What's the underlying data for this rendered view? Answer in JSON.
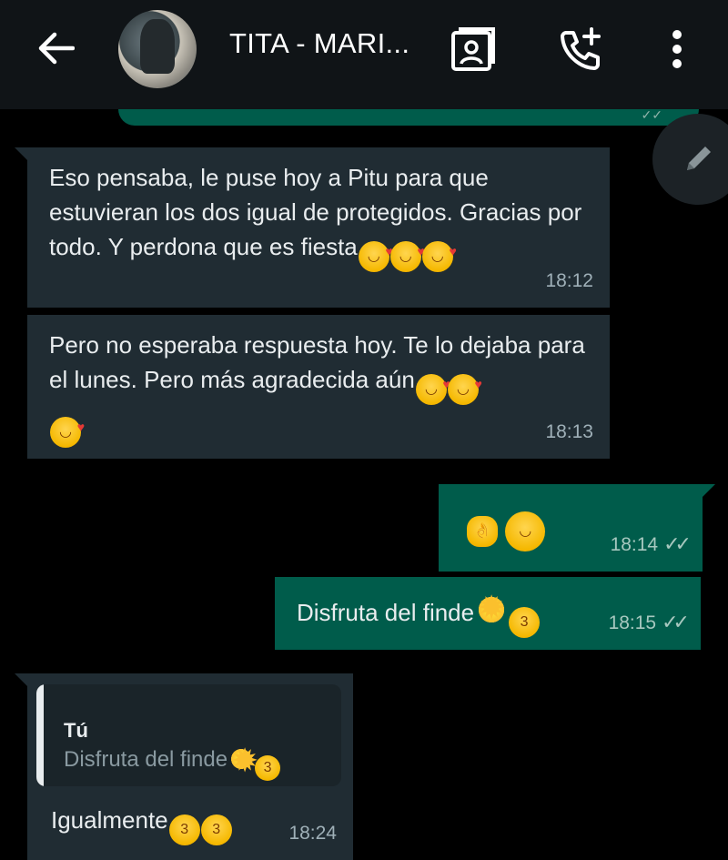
{
  "header": {
    "back_icon": "arrow-left-icon",
    "contact_name": "TITA - MARI...",
    "contact_card_icon": "contact-card-icon",
    "add_call_icon": "call-add-icon",
    "menu_icon": "more-vertical-icon"
  },
  "fab": {
    "icon": "pencil-icon"
  },
  "messages": [
    {
      "direction": "in",
      "text": "Eso pensaba, le puse hoy a Pitu para que estuvieran los dos igual de protegidos. Gracias por todo. Y perdona que es fiesta",
      "emojis": [
        "smiling-face-with-hearts",
        "smiling-face-with-hearts",
        "smiling-face-with-hearts"
      ],
      "time": "18:12"
    },
    {
      "direction": "in",
      "text": "Pero no esperaba respuesta hoy. Te lo dejaba para el lunes. Pero más agradecida aún",
      "emojis": [
        "smiling-face-with-hearts",
        "smiling-face-with-hearts",
        "smiling-face-with-hearts"
      ],
      "time": "18:13"
    },
    {
      "direction": "out",
      "text": "",
      "emojis": [
        "ok-hand",
        "hugging-face"
      ],
      "time": "18:14",
      "status": "read"
    },
    {
      "direction": "out",
      "text": "Disfruta del finde",
      "emojis": [
        "sun",
        "face-blowing-kiss"
      ],
      "time": "18:15",
      "status": "read"
    },
    {
      "direction": "in",
      "quote": {
        "author": "Tú",
        "text": "Disfruta del finde"
      },
      "text": "Igualmente",
      "emojis": [
        "face-blowing-kiss",
        "face-blowing-kiss"
      ],
      "time": "18:24"
    }
  ],
  "colors": {
    "background": "#000000",
    "header": "#101417",
    "incoming_bubble": "#202c33",
    "outgoing_bubble": "#005c4b",
    "text": "#e9edef",
    "meta": "#9fb0b8"
  }
}
